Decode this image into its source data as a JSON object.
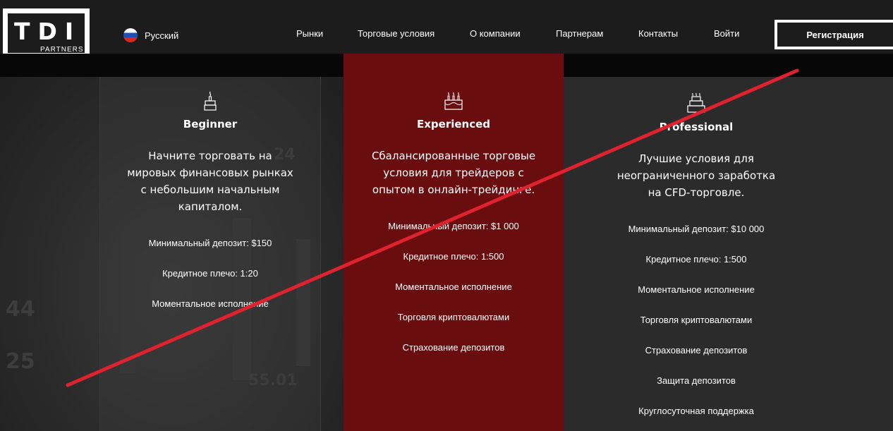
{
  "logo": {
    "main": "TDI",
    "sub": "PARTNERS"
  },
  "language": {
    "label": "Русский"
  },
  "nav": {
    "markets": "Рынки",
    "trading_conditions": "Торговые условия",
    "about": "О компании",
    "partners": "Партнерам",
    "contacts": "Контакты",
    "login": "Войти"
  },
  "register_label": "Регистрация",
  "background_numbers": [
    "44",
    "25",
    "55.01",
    "24"
  ],
  "plans": {
    "beginner": {
      "title": "Beginner",
      "desc": [
        "Начните торговать на",
        "мировых финансовых рынках",
        "с небольшим начальным",
        "капиталом."
      ],
      "features": [
        "Минимальный депозит: $150",
        "Кредитное плечо: 1:20",
        "Моментальное исполнение"
      ]
    },
    "experienced": {
      "title": "Experienced",
      "desc": [
        "Сбалансированные торговые",
        "условия для трейдеров с",
        "опытом в онлайн-трейдинге."
      ],
      "features": [
        "Минимальный депозит: $1 000",
        "Кредитное плечо: 1:500",
        "Моментальное исполнение",
        "Торговля криптовалютами",
        "Страхование депозитов"
      ]
    },
    "professional": {
      "title": "Professional",
      "desc": [
        "Лучшие условия для",
        "неограниченного заработка",
        "на CFD-торговле."
      ],
      "features": [
        "Минимальный депозит: $10 000",
        "Кредитное плечо: 1:500",
        "Моментальное исполнение",
        "Торговля криптовалютами",
        "Страхование депозитов",
        "Защита депозитов",
        "Круглосуточная поддержка"
      ]
    }
  },
  "colors": {
    "header_bg": "#1c1c1c",
    "experienced_bg": "#6a0d0f",
    "strike_line": "#e0212e"
  },
  "icons": {
    "beginner": "cake-one-candle-icon",
    "experienced": "cake-three-candles-icon",
    "professional": "cake-tiered-icon"
  }
}
